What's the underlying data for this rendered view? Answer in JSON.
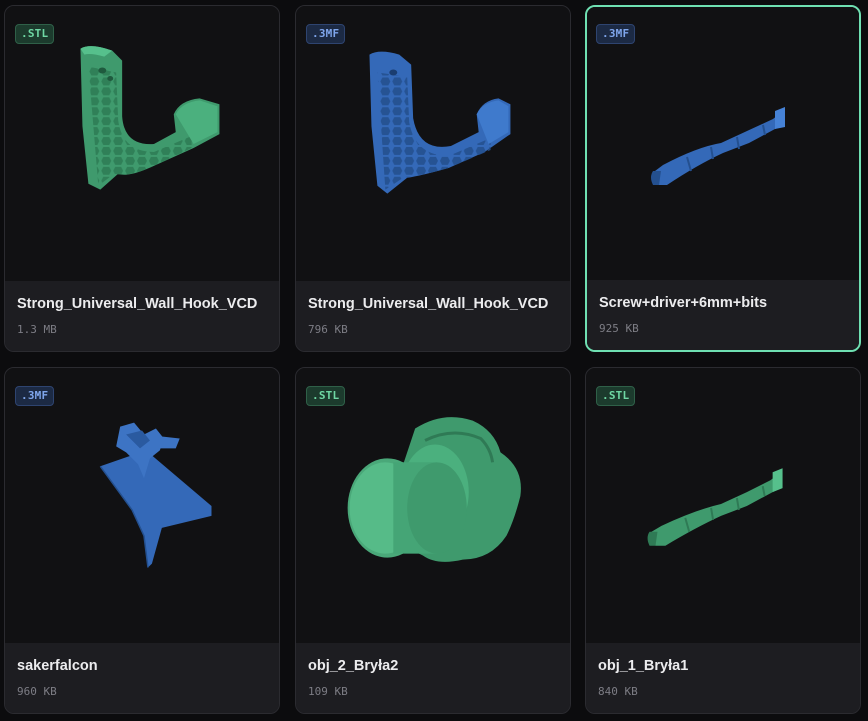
{
  "colors": {
    "green_model": "#3f9a6d",
    "blue_model": "#3469b8",
    "accent_selected": "#6fe0b2"
  },
  "files": [
    {
      "name": "Strong_Universal_Wall_Hook_VCD",
      "size": "1.3 MB",
      "format": ".STL",
      "selected": false
    },
    {
      "name": "Strong_Universal_Wall_Hook_VCD",
      "size": "796 KB",
      "format": ".3MF",
      "selected": false
    },
    {
      "name": "Screw+driver+6mm+bits",
      "size": "925 KB",
      "format": ".3MF",
      "selected": true
    },
    {
      "name": "sakerfalcon",
      "size": "960 KB",
      "format": ".3MF",
      "selected": false
    },
    {
      "name": "obj_2_Bryła2",
      "size": "109 KB",
      "format": ".STL",
      "selected": false
    },
    {
      "name": "obj_1_Bryła1",
      "size": "840 KB",
      "format": ".STL",
      "selected": false
    }
  ]
}
